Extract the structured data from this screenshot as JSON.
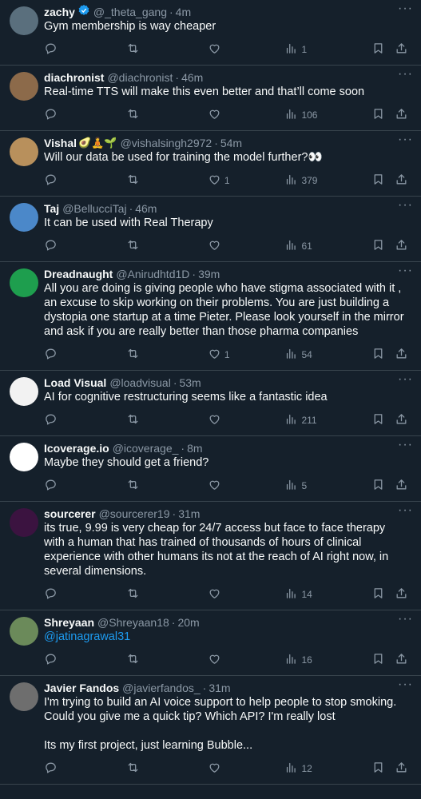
{
  "tweets": [
    {
      "name": "zachy",
      "verified": true,
      "emoji": "",
      "handle": "@_theta_gang",
      "time": "4m",
      "text": [
        "Gym membership is way cheaper"
      ],
      "likes": "",
      "views": "1",
      "avatar": "#5a6f7d"
    },
    {
      "name": "diachronist",
      "verified": false,
      "emoji": "",
      "handle": "@diachronist",
      "time": "46m",
      "text": [
        "Real-time TTS will make this even better and that’ll come soon"
      ],
      "likes": "",
      "views": "106",
      "avatar": "#8c6a4a"
    },
    {
      "name": "Vishal",
      "verified": false,
      "emoji": "🥑🧘🌱",
      "handle": "@vishalsingh2972",
      "time": "54m",
      "text": [
        "Will our data be used for training the model further?👀"
      ],
      "likes": "1",
      "views": "379",
      "avatar": "#b8905c"
    },
    {
      "name": "Taj",
      "verified": false,
      "emoji": "",
      "handle": "@BellucciTaj",
      "time": "46m",
      "text": [
        "It can be used with Real Therapy"
      ],
      "likes": "",
      "views": "61",
      "avatar": "#4b88c9"
    },
    {
      "name": "Dreadnaught",
      "verified": false,
      "emoji": "",
      "handle": "@Anirudhtd1D",
      "time": "39m",
      "text": [
        "All you are doing is giving people who have stigma associated with it , an excuse to skip working on their problems. You are just building a dystopia one startup at a time Pieter. Please look yourself in the mirror and ask if you are really better than those pharma companies"
      ],
      "likes": "1",
      "views": "54",
      "avatar": "#1e9e4e"
    },
    {
      "name": "Load Visual",
      "verified": false,
      "emoji": "",
      "handle": "@loadvisual",
      "time": "53m",
      "text": [
        "AI for cognitive restructuring seems like a fantastic idea"
      ],
      "likes": "",
      "views": "211",
      "avatar": "#f2f2f2"
    },
    {
      "name": "Icoverage.io",
      "verified": false,
      "emoji": "",
      "handle": "@icoverage_",
      "time": "8m",
      "text": [
        "Maybe they should get a friend?"
      ],
      "likes": "",
      "views": "5",
      "avatar": "#ffffff"
    },
    {
      "name": "sourcerer",
      "verified": false,
      "emoji": "",
      "handle": "@sourcerer19",
      "time": "31m",
      "text": [
        "its true, 9.99 is very cheap for 24/7 access but face to face therapy with a human that has trained of thousands of hours of clinical experience with other humans its not at the reach of AI right now, in several dimensions."
      ],
      "likes": "",
      "views": "14",
      "avatar": "#3b1340"
    },
    {
      "name": "Shreyaan",
      "verified": false,
      "emoji": "",
      "handle": "@Shreyaan18",
      "time": "20m",
      "text": [],
      "mention": "@jatinagrawal31",
      "likes": "",
      "views": "16",
      "avatar": "#6b8a5a"
    },
    {
      "name": "Javier Fandos",
      "verified": false,
      "emoji": "",
      "handle": "@javierfandos_",
      "time": "31m",
      "text": [
        "I'm trying to build an AI voice support to help people to stop smoking. Could you give me a quick tip?  Which API?  I'm really lost",
        "",
        "Its my first project, just learning  Bubble..."
      ],
      "likes": "",
      "views": "12",
      "avatar": "#6e6e6e"
    }
  ]
}
